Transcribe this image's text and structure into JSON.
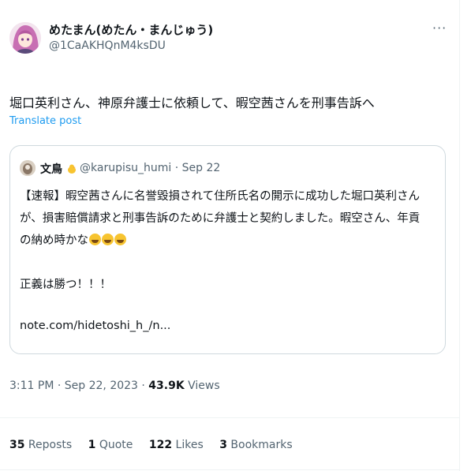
{
  "author": {
    "name": "めたまん(めたん・まんじゅう)",
    "handle": "@1CaAKHQnM4ksDU"
  },
  "more_label": "···",
  "tweet_text": "堀口英利さん、神原弁護士に依頼して、暇空茜さんを刑事告訴へ",
  "translate_label": "Translate post",
  "quoted": {
    "name": "文鳥",
    "handle_date": "@karupisu_humi · Sep 22",
    "lines": [
      "【速報】暇空茜さんに名誉毀損されて住所氏名の開示に成功した堀口英利さん",
      "が、損害賠償請求と刑事告訴のために弁護士と契約しました。暇空さん、年貢",
      "の納め時かな",
      "正義は勝つ！！！",
      "note.com/hidetoshi_h_/n..."
    ],
    "emoji_icons": [
      "rolling-on-floor-laughing",
      "rolling-on-floor-laughing",
      "rolling-on-floor-laughing"
    ]
  },
  "meta": {
    "time_date": "3:11 PM · Sep 22, 2023 · ",
    "views_count": "43.9K",
    "views_label": " Views"
  },
  "stats": {
    "reposts_count": "35",
    "reposts_label": " Reposts",
    "quotes_count": "1",
    "quotes_label": " Quote",
    "likes_count": "122",
    "likes_label": " Likes",
    "bookmarks_count": "3",
    "bookmarks_label": " Bookmarks"
  },
  "colors": {
    "link": "#1d9bf0",
    "secondary_text": "#536471",
    "primary_text": "#0f1419",
    "border": "#cfd9de"
  }
}
